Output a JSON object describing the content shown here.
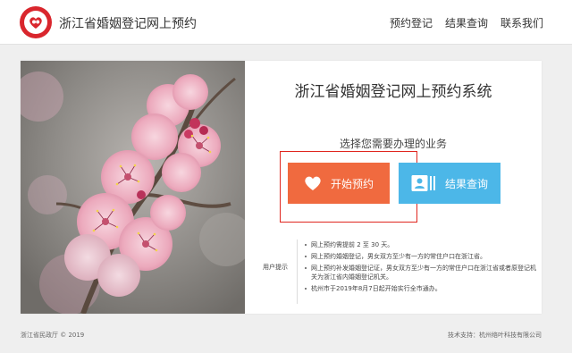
{
  "header": {
    "site_title": "浙江省婚姻登记网上预约",
    "nav": [
      {
        "label": "预约登记"
      },
      {
        "label": "结果查询"
      },
      {
        "label": "联系我们"
      }
    ]
  },
  "main": {
    "system_title": "浙江省婚姻登记网上预约系统",
    "subtitle": "选择您需要办理的业务",
    "buttons": {
      "start_label": "开始预约",
      "query_label": "结果查询"
    },
    "tips": {
      "label": "用户提示",
      "items": [
        "网上预约需提前 2 至 30 天。",
        "网上预约婚姻登记，男女双方至少有一方的常住户口在浙江省。",
        "网上预约补发婚姻登记证，男女双方至少有一方的常住户口在浙江省或者原登记机关为浙江省内婚姻登记机关。",
        "杭州市于2019年8月7日起开始实行全市通办。"
      ]
    }
  },
  "footer": {
    "copyright": "浙江省民政厅 © 2019",
    "support": "技术支持：杭州络叶科技有限公司"
  },
  "colors": {
    "brand_red": "#d9262d",
    "start_button": "#f06a3f",
    "query_button": "#4cb7e8",
    "highlight_box": "#e0261f"
  },
  "icons": {
    "logo": "marriage-registration-logo",
    "start": "heart-icon",
    "query": "id-card-icon"
  }
}
